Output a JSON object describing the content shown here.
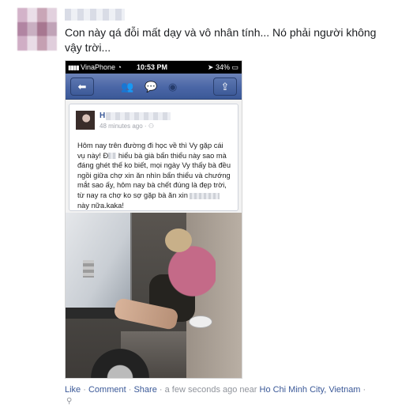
{
  "post": {
    "text": "Con này qá đỗi mất dạy và vô nhân tính... Nó phải người không vậy trời..."
  },
  "phone": {
    "status": {
      "carrier": "VinaPhone",
      "time": "10:53 PM",
      "battery": "34%"
    },
    "card": {
      "name_initial": "H",
      "time": "48 minutes ago",
      "body_1": "Hôm nay trên đường đi học về thì Vy gặp cái vụ này! Đ",
      "body_2": " hiểu bà già bẩn thiểu này sao mà đáng ghét thế ko biết, mọi ngày Vy thấy bà đều ngồi giữa chợ xin ăn nhìn bẩn thiểu và chướng mắt sao ấy, hôm nay bà chết đúng là đẹp trời, từ nay ra chợ ko sợ gặp bà ăn xin",
      "body_3": " này nữa.kaka!"
    }
  },
  "actions": {
    "like": "Like",
    "comment": "Comment",
    "share": "Share",
    "meta": "a few seconds ago near",
    "location": "Ho Chi Minh City, Vietnam",
    "separator": "·",
    "trailing": " ·"
  },
  "icons": [
    "signal-icon",
    "wifi-icon",
    "back-arrow-icon",
    "friends-icon",
    "messages-icon",
    "globe-icon",
    "share-icon",
    "map-pin-icon"
  ],
  "colors": {
    "facebook_blue": "#3b5998",
    "meta_gray": "#90949c"
  }
}
